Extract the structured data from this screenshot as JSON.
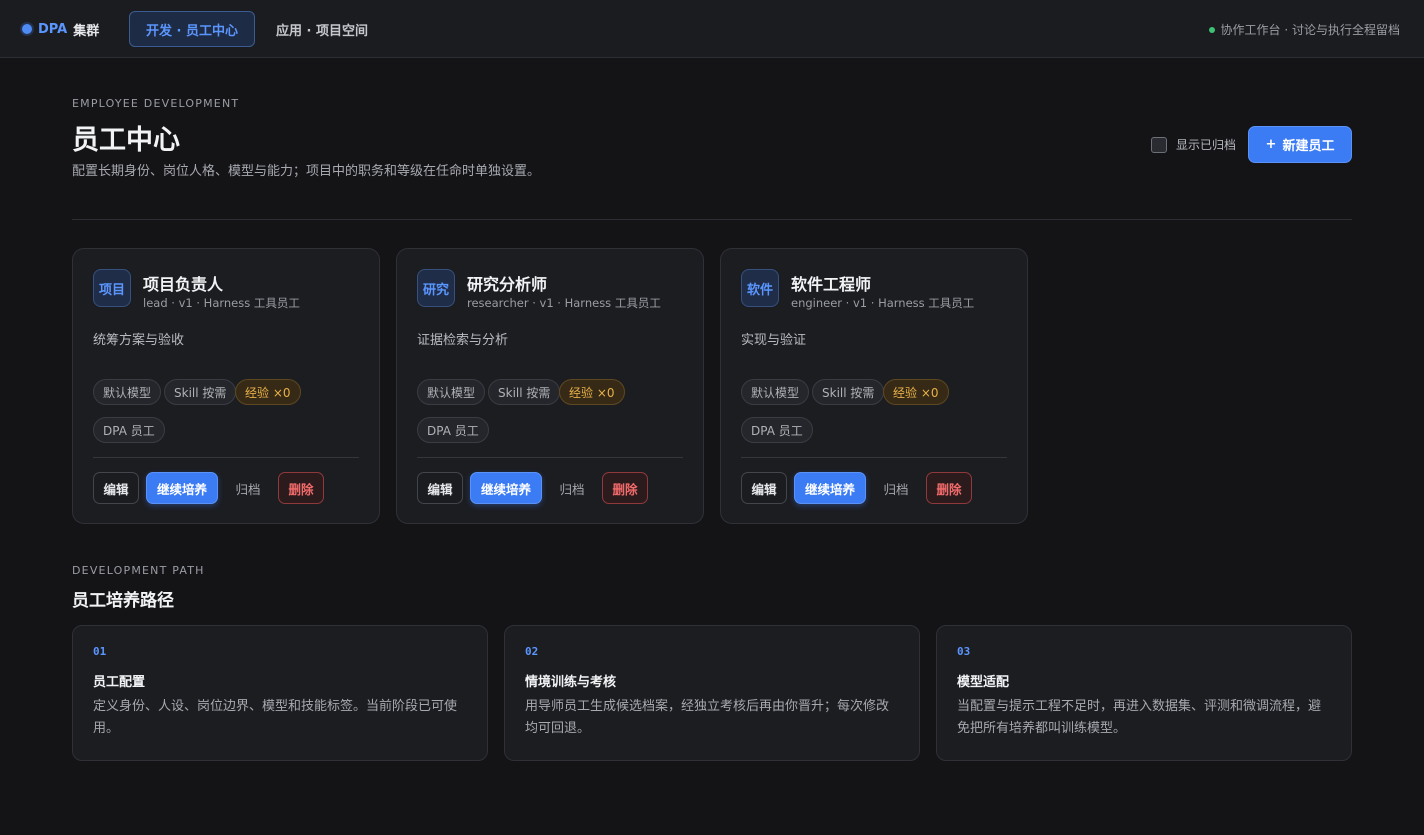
{
  "topbar": {
    "brand_name": "DPA",
    "brand_sub": "集群",
    "tabs": [
      {
        "label": "开发 · 员工中心"
      },
      {
        "label": "应用 · 项目空间"
      }
    ],
    "status": "协作工作台 · 讨论与执行全程留档"
  },
  "header": {
    "eyebrow": "EMPLOYEE DEVELOPMENT",
    "title": "员工中心",
    "description": "配置长期身份、岗位人格、模型与能力；项目中的职务和等级在任命时单独设置。",
    "show_archived_label": "显示已归档",
    "show_archived_checked": false,
    "new_employee_label": "新建员工",
    "new_employee_icon": "plus-icon"
  },
  "employees": [
    {
      "avatar": "项目",
      "name": "项目负责人",
      "meta": "lead · v1 · Harness 工具员工",
      "description": "统筹方案与验收",
      "tags": [
        "默认模型",
        "Skill 按需",
        "经验 ×0",
        "DPA 员工"
      ],
      "actions": {
        "edit": "编辑",
        "train": "继续培养",
        "archive": "归档",
        "delete": "删除"
      }
    },
    {
      "avatar": "研究",
      "name": "研究分析师",
      "meta": "researcher · v1 · Harness 工具员工",
      "description": "证据检索与分析",
      "tags": [
        "默认模型",
        "Skill 按需",
        "经验 ×0",
        "DPA 员工"
      ],
      "actions": {
        "edit": "编辑",
        "train": "继续培养",
        "archive": "归档",
        "delete": "删除"
      }
    },
    {
      "avatar": "软件",
      "name": "软件工程师",
      "meta": "engineer · v1 · Harness 工具员工",
      "description": "实现与验证",
      "tags": [
        "默认模型",
        "Skill 按需",
        "经验 ×0",
        "DPA 员工"
      ],
      "actions": {
        "edit": "编辑",
        "train": "继续培养",
        "archive": "归档",
        "delete": "删除"
      }
    }
  ],
  "path": {
    "eyebrow": "DEVELOPMENT PATH",
    "title": "员工培养路径",
    "steps": [
      {
        "num": "01",
        "title": "员工配置",
        "description": "定义身份、人设、岗位边界、模型和技能标签。当前阶段已可使用。"
      },
      {
        "num": "02",
        "title": "情境训练与考核",
        "description": "用导师员工生成候选档案，经独立考核后再由你晋升；每次修改均可回退。"
      },
      {
        "num": "03",
        "title": "模型适配",
        "description": "当配置与提示工程不足时，再进入数据集、评测和微调流程，避免把所有培养都叫训练模型。"
      }
    ]
  },
  "colors": {
    "accent": "#3b7cf5",
    "accent_text": "#5b96ff",
    "experience": "#e8b04a",
    "danger": "#f26b6b",
    "online": "#3ec172"
  }
}
